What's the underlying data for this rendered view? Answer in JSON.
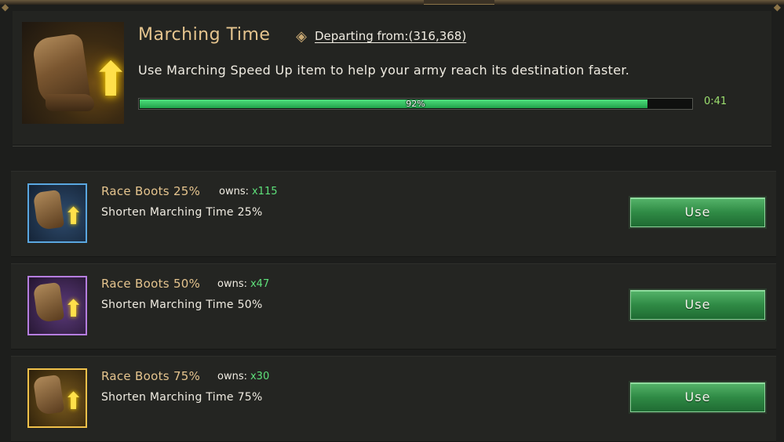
{
  "header": {
    "title": "Marching Time",
    "departing": "Departing from:(316,368)",
    "description": "Use Marching Speed Up item to help your army reach its destination faster.",
    "progress_label": "92%",
    "progress_percent": 92,
    "timer": "0:41"
  },
  "items": [
    {
      "name": "Race Boots 25%",
      "owns_label": "owns:",
      "owns_count": "x115",
      "description": "Shorten Marching Time 25%",
      "button": "Use",
      "rarity": "blue"
    },
    {
      "name": "Race Boots 50%",
      "owns_label": "owns:",
      "owns_count": "x47",
      "description": "Shorten Marching Time 50%",
      "button": "Use",
      "rarity": "purple"
    },
    {
      "name": "Race Boots 75%",
      "owns_label": "owns:",
      "owns_count": "x30",
      "description": "Shorten Marching Time 75%",
      "button": "Use",
      "rarity": "gold"
    }
  ],
  "icons": {
    "hero": "boot-speed-icon",
    "departing": "location-pin-icon",
    "arrow": "up-arrow-icon"
  },
  "colors": {
    "accent_gold": "#e5c48e",
    "progress_green": "#2fbf5a",
    "count_green": "#5ee07a",
    "button_green": "#2f8a45"
  }
}
